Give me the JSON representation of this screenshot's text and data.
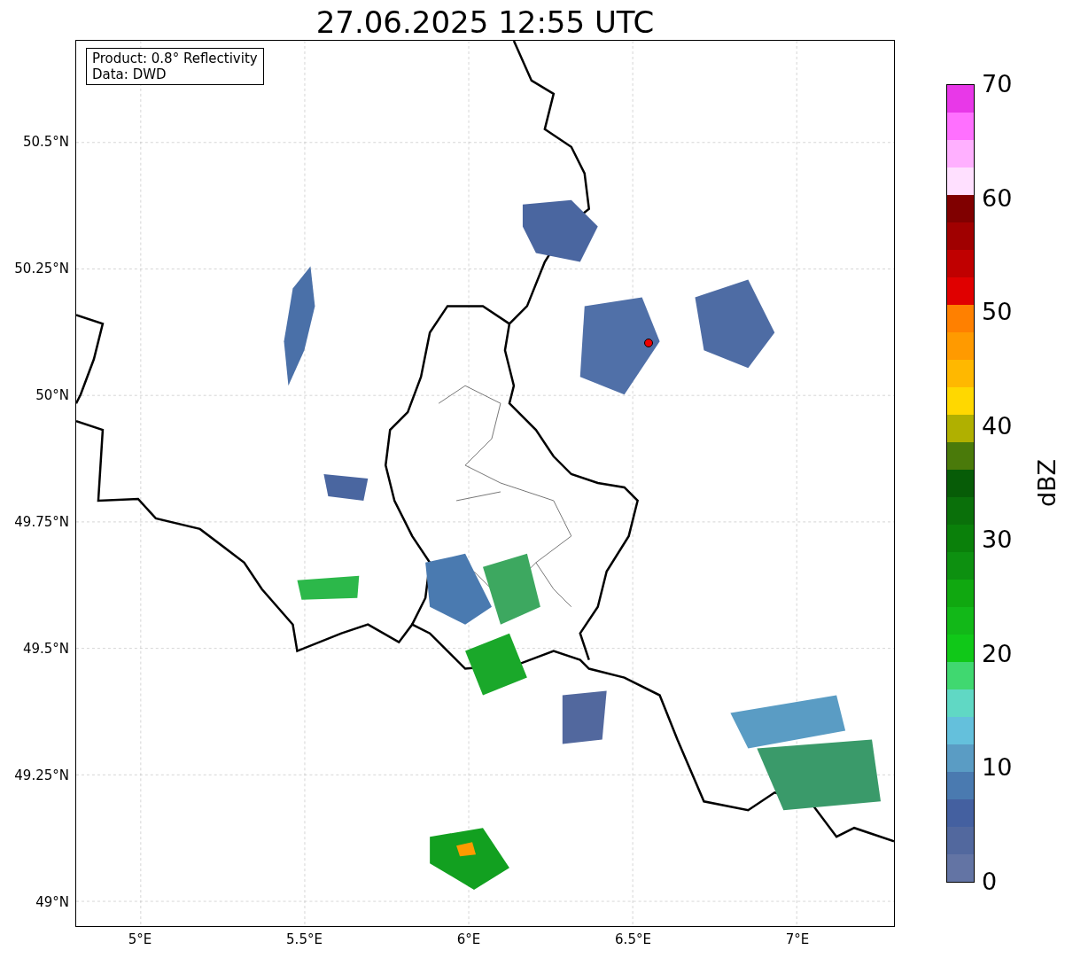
{
  "title": "27.06.2025 12:55 UTC",
  "map": {
    "info": [
      "Product: 0.8° Reflectivity",
      "Data: DWD"
    ],
    "y_ticks": [
      "50.5°N",
      "50.25°N",
      "50°N",
      "49.75°N",
      "49.5°N",
      "49.25°N",
      "49°N"
    ],
    "x_ticks": [
      "5°E",
      "5.5°E",
      "6°E",
      "6.5°E",
      "7°E"
    ]
  },
  "colorbar": {
    "label": "dBZ",
    "ticks": [
      "70",
      "60",
      "50",
      "40",
      "30",
      "20",
      "10",
      "0"
    ],
    "bands": [
      {
        "color": "#e838e8"
      },
      {
        "color": "#ff70ff"
      },
      {
        "color": "#ffb0ff"
      },
      {
        "color": "#ffe0ff"
      },
      {
        "color": "#800000"
      },
      {
        "color": "#a00000"
      },
      {
        "color": "#c00000"
      },
      {
        "color": "#e00000"
      },
      {
        "color": "#ff8000"
      },
      {
        "color": "#ff9a00"
      },
      {
        "color": "#ffb800"
      },
      {
        "color": "#ffd800"
      },
      {
        "color": "#b0b000"
      },
      {
        "color": "#4a7a0a"
      },
      {
        "color": "#075c07"
      },
      {
        "color": "#0a700a"
      },
      {
        "color": "#0a800a"
      },
      {
        "color": "#0d9010"
      },
      {
        "color": "#10a810"
      },
      {
        "color": "#12b818"
      },
      {
        "color": "#10c818"
      },
      {
        "color": "#40d870"
      },
      {
        "color": "#60d8c4"
      },
      {
        "color": "#64c0dc"
      },
      {
        "color": "#5a9cc4"
      },
      {
        "color": "#4a7ab0"
      },
      {
        "color": "#4460a0"
      },
      {
        "color": "#52689e"
      },
      {
        "color": "#6374a4"
      }
    ]
  }
}
